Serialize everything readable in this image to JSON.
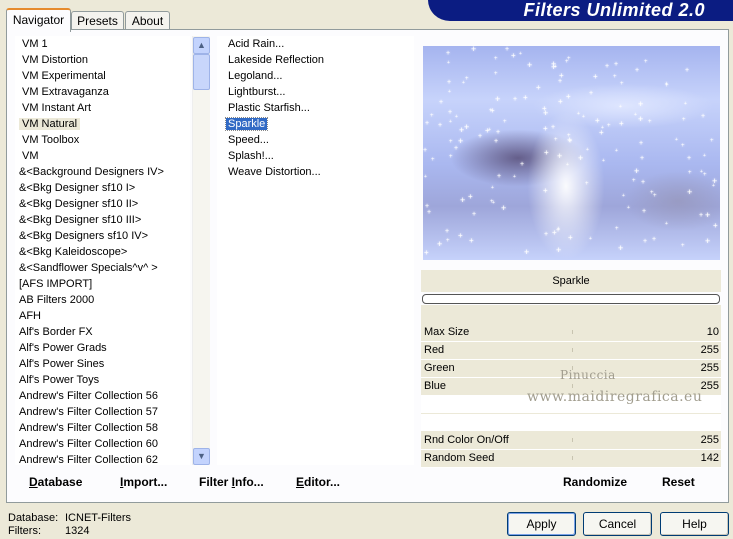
{
  "app": {
    "title": "Filters Unlimited 2.0"
  },
  "tabs": [
    {
      "label": "Navigator",
      "active": true
    },
    {
      "label": "Presets",
      "active": false
    },
    {
      "label": "About",
      "active": false
    }
  ],
  "categories": {
    "items": [
      "VM 1",
      "VM Distortion",
      "VM Experimental",
      "VM Extravaganza",
      "VM Instant Art",
      "VM Natural",
      "VM Toolbox",
      "VM",
      "&<Background Designers IV>",
      "&<Bkg Designer sf10 I>",
      "&<Bkg Designer sf10 II>",
      "&<Bkg Designer sf10 III>",
      "&<Bkg Designers sf10 IV>",
      "&<Bkg Kaleidoscope>",
      "&<Sandflower Specials^v^ >",
      "[AFS IMPORT]",
      "AB Filters 2000",
      "AFH",
      "Alf's Border FX",
      "Alf's Power Grads",
      "Alf's Power Sines",
      "Alf's Power Toys",
      "Andrew's Filter Collection 56",
      "Andrew's Filter Collection 57",
      "Andrew's Filter Collection 58",
      "Andrew's Filter Collection 60",
      "Andrew's Filter Collection 62"
    ],
    "selected_index": 5
  },
  "filters": {
    "items": [
      "Acid Rain...",
      "Lakeside Reflection",
      "Legoland...",
      "Lightburst...",
      "Plastic Starfish...",
      "Sparkle",
      "Speed...",
      "Splash!...",
      "Weave Distortion..."
    ],
    "selected_index": 5
  },
  "preview": {
    "filter_name": "Sparkle",
    "progress": 0
  },
  "params": [
    {
      "label": "Max Size",
      "value": "10"
    },
    {
      "label": "Red",
      "value": "255"
    },
    {
      "label": "Green",
      "value": "255"
    },
    {
      "label": "Blue",
      "value": "255"
    },
    {
      "label": "Rnd Color On/Off",
      "value": "255"
    },
    {
      "label": "Random Seed",
      "value": "142"
    }
  ],
  "watermark": {
    "line1": "Pinuccia",
    "line2": "www.maidiregrafica.eu"
  },
  "toolbar": {
    "database": {
      "u": "D",
      "rest": "atabase"
    },
    "import": {
      "u": "I",
      "rest": "mport..."
    },
    "filter_info": {
      "pre": "Filter ",
      "u": "I",
      "rest": "nfo..."
    },
    "editor": {
      "u": "E",
      "rest": "ditor..."
    },
    "randomize": "Randomize",
    "reset": "Reset"
  },
  "status": {
    "database_label": "Database:",
    "database_value": "ICNET-Filters",
    "filters_label": "Filters:",
    "filters_value": "1324"
  },
  "buttons": {
    "apply": "Apply",
    "cancel": "Cancel",
    "help": "Help"
  },
  "colors": {
    "banner": "#0b1c82",
    "selection": "#316ac5",
    "tab_accent": "#e68b2c"
  }
}
